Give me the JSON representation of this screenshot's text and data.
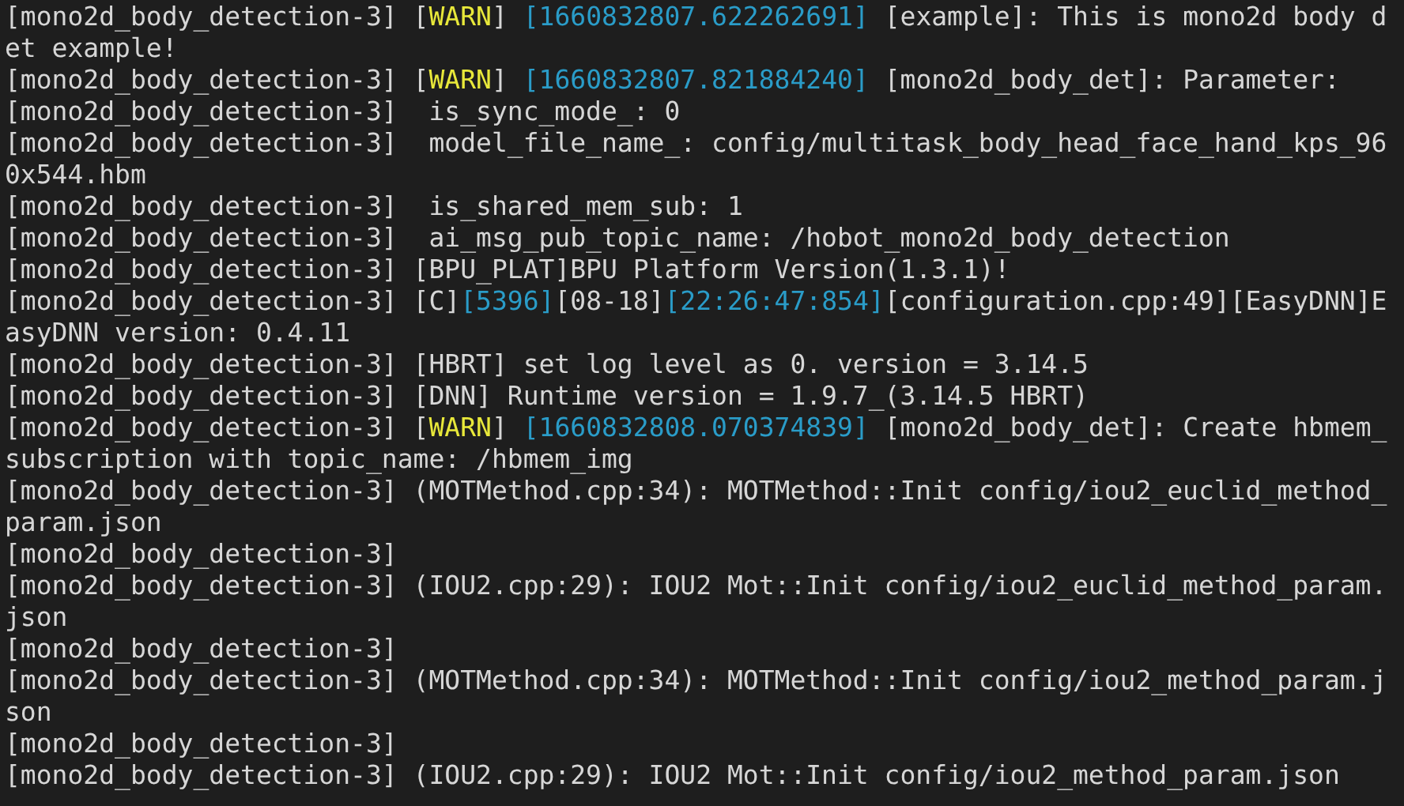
{
  "terminal": {
    "lines": [
      {
        "segments": [
          {
            "kind": "text",
            "text": "[mono2d_body_detection-3] ["
          },
          {
            "kind": "level",
            "text": "WARN"
          },
          {
            "kind": "text",
            "text": "] "
          },
          {
            "kind": "stamp",
            "text": "[1660832807.622262691]"
          },
          {
            "kind": "text",
            "text": " [example]: This is mono2d body d"
          }
        ]
      },
      {
        "segments": [
          {
            "kind": "text",
            "text": "et example!"
          }
        ]
      },
      {
        "segments": [
          {
            "kind": "text",
            "text": "[mono2d_body_detection-3] ["
          },
          {
            "kind": "level",
            "text": "WARN"
          },
          {
            "kind": "text",
            "text": "] "
          },
          {
            "kind": "stamp",
            "text": "[1660832807.821884240]"
          },
          {
            "kind": "text",
            "text": " [mono2d_body_det]: Parameter:"
          }
        ]
      },
      {
        "segments": [
          {
            "kind": "text",
            "text": "[mono2d_body_detection-3]  is_sync_mode_: 0"
          }
        ]
      },
      {
        "segments": [
          {
            "kind": "text",
            "text": "[mono2d_body_detection-3]  model_file_name_: config/multitask_body_head_face_hand_kps_96"
          }
        ]
      },
      {
        "segments": [
          {
            "kind": "text",
            "text": "0x544.hbm"
          }
        ]
      },
      {
        "segments": [
          {
            "kind": "text",
            "text": "[mono2d_body_detection-3]  is_shared_mem_sub: 1"
          }
        ]
      },
      {
        "segments": [
          {
            "kind": "text",
            "text": "[mono2d_body_detection-3]  ai_msg_pub_topic_name: /hobot_mono2d_body_detection"
          }
        ]
      },
      {
        "segments": [
          {
            "kind": "text",
            "text": "[mono2d_body_detection-3] [BPU_PLAT]BPU Platform Version(1.3.1)!"
          }
        ]
      },
      {
        "segments": [
          {
            "kind": "text",
            "text": "[mono2d_body_detection-3] [C]"
          },
          {
            "kind": "stamp",
            "text": "[5396]"
          },
          {
            "kind": "text",
            "text": "[08-18]"
          },
          {
            "kind": "stamp",
            "text": "[22:26:47:854]"
          },
          {
            "kind": "text",
            "text": "[configuration.cpp:49][EasyDNN]E"
          }
        ]
      },
      {
        "segments": [
          {
            "kind": "text",
            "text": "asyDNN version: 0.4.11"
          }
        ]
      },
      {
        "segments": [
          {
            "kind": "text",
            "text": "[mono2d_body_detection-3] [HBRT] set log level as 0. version = 3.14.5"
          }
        ]
      },
      {
        "segments": [
          {
            "kind": "text",
            "text": "[mono2d_body_detection-3] [DNN] Runtime version = 1.9.7_(3.14.5 HBRT)"
          }
        ]
      },
      {
        "segments": [
          {
            "kind": "text",
            "text": "[mono2d_body_detection-3] ["
          },
          {
            "kind": "level",
            "text": "WARN"
          },
          {
            "kind": "text",
            "text": "] "
          },
          {
            "kind": "stamp",
            "text": "[1660832808.070374839]"
          },
          {
            "kind": "text",
            "text": " [mono2d_body_det]: Create hbmem_"
          }
        ]
      },
      {
        "segments": [
          {
            "kind": "text",
            "text": "subscription with topic_name: /hbmem_img"
          }
        ]
      },
      {
        "segments": [
          {
            "kind": "text",
            "text": "[mono2d_body_detection-3] (MOTMethod.cpp:34): MOTMethod::Init config/iou2_euclid_method_"
          }
        ]
      },
      {
        "segments": [
          {
            "kind": "text",
            "text": "param.json"
          }
        ]
      },
      {
        "segments": [
          {
            "kind": "text",
            "text": "[mono2d_body_detection-3]"
          }
        ]
      },
      {
        "segments": [
          {
            "kind": "text",
            "text": "[mono2d_body_detection-3] (IOU2.cpp:29): IOU2 Mot::Init config/iou2_euclid_method_param."
          }
        ]
      },
      {
        "segments": [
          {
            "kind": "text",
            "text": "json"
          }
        ]
      },
      {
        "segments": [
          {
            "kind": "text",
            "text": "[mono2d_body_detection-3]"
          }
        ]
      },
      {
        "segments": [
          {
            "kind": "text",
            "text": "[mono2d_body_detection-3] (MOTMethod.cpp:34): MOTMethod::Init config/iou2_method_param.j"
          }
        ]
      },
      {
        "segments": [
          {
            "kind": "text",
            "text": "son"
          }
        ]
      },
      {
        "segments": [
          {
            "kind": "text",
            "text": "[mono2d_body_detection-3]"
          }
        ]
      },
      {
        "segments": [
          {
            "kind": "text",
            "text": "[mono2d_body_detection-3] (IOU2.cpp:29): IOU2 Mot::Init config/iou2_method_param.json"
          }
        ]
      }
    ]
  }
}
